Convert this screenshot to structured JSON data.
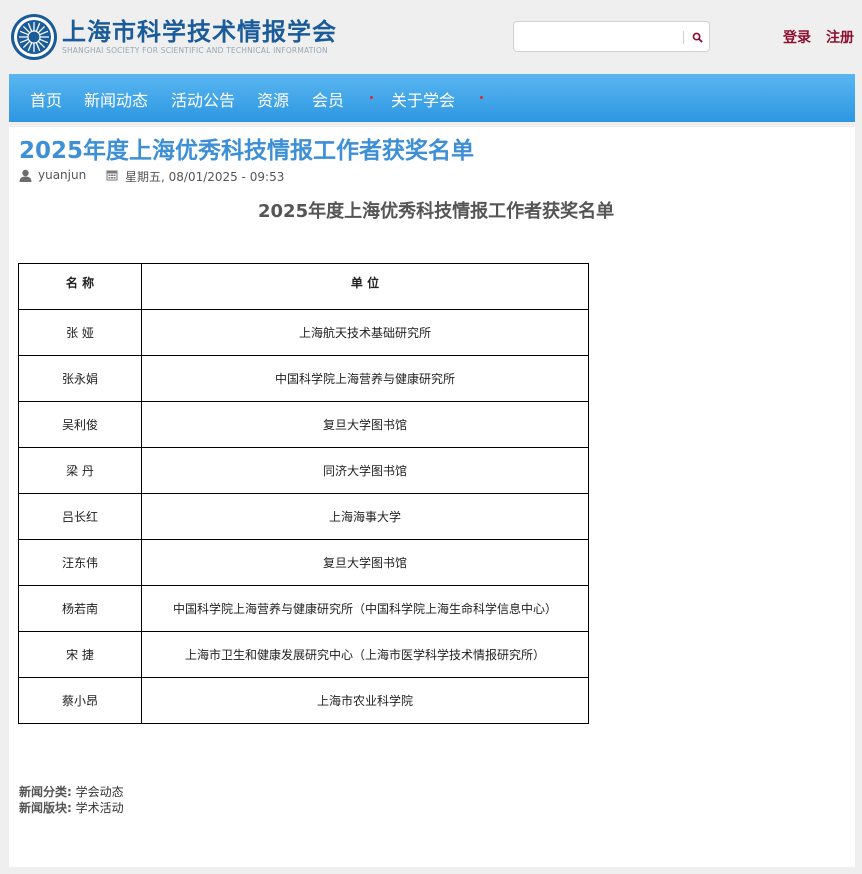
{
  "header": {
    "site_title": "上海市科学技术情报学会",
    "site_subtitle": "SHANGHAI SOCIETY FOR SCIENTIFIC AND TECHNICAL INFORMATION",
    "search_value": "",
    "login_label": "登录",
    "register_label": "注册",
    "icons": {
      "logo": "society-logo-icon",
      "search": "search-icon"
    }
  },
  "nav": {
    "items": [
      "首页",
      "新闻动态",
      "活动公告",
      "资源",
      "会员",
      "关于学会"
    ]
  },
  "article": {
    "title": "2025年度上海优秀科技情报工作者获奖名单",
    "author": "yuanjun",
    "date": "星期五, 08/01/2025 - 09:53",
    "subtitle": "2025年度上海优秀科技情报工作者获奖名单",
    "table": {
      "headers": [
        "名  称",
        "单  位"
      ],
      "rows": [
        [
          "张  娅",
          "上海航天技术基础研究所"
        ],
        [
          "张永娟",
          "中国科学院上海营养与健康研究所"
        ],
        [
          "吴利俊",
          "复旦大学图书馆"
        ],
        [
          "梁  丹",
          "同济大学图书馆"
        ],
        [
          "吕长红",
          "上海海事大学"
        ],
        [
          "汪东伟",
          "复旦大学图书馆"
        ],
        [
          "杨若南",
          "中国科学院上海营养与健康研究所（中国科学院上海生命科学信息中心）"
        ],
        [
          "宋  捷",
          "上海市卫生和健康发展研究中心（上海市医学科学技术情报研究所）"
        ],
        [
          "蔡小昂",
          "上海市农业科学院"
        ]
      ]
    },
    "category_label": "新闻分类:",
    "category_value": "学会动态",
    "section_label": "新闻版块:",
    "section_value": "学术活动"
  },
  "colors": {
    "brand_blue": "#1a5b9a",
    "nav_blue": "#3aa3e8",
    "title_blue": "#3d8fd6",
    "accent_red": "#8c1130"
  }
}
